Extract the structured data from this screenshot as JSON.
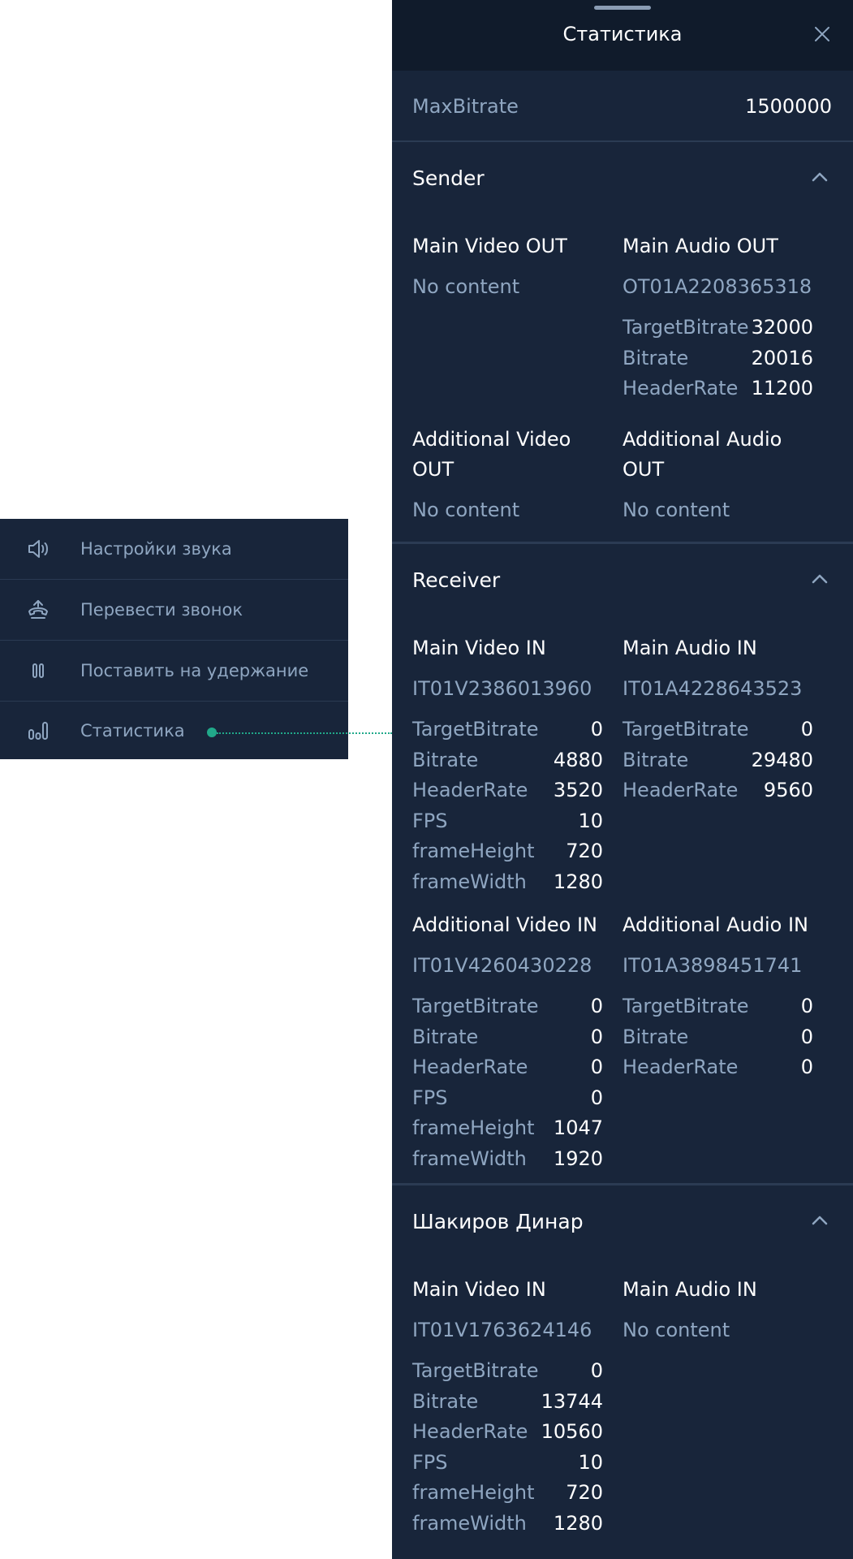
{
  "menu": {
    "items": [
      {
        "label": "Настройки звука",
        "icon": "speaker-icon"
      },
      {
        "label": "Перевести звонок",
        "icon": "call-transfer-icon"
      },
      {
        "label": "Поставить на удержание",
        "icon": "pause-icon"
      },
      {
        "label": "Статистика",
        "icon": "statistics-icon"
      }
    ]
  },
  "panel": {
    "title": "Статистика",
    "max_bitrate_label": "MaxBitrate",
    "max_bitrate_value": "1500000",
    "colors": {
      "panel_bg": "#18253a",
      "header_bg": "#101b2b",
      "accent": "#21a98a",
      "muted_text": "#8fa6c1"
    }
  },
  "sender": {
    "title": "Sender",
    "main_video": {
      "title": "Main Video OUT",
      "id": "No content"
    },
    "main_audio": {
      "title": "Main Audio OUT",
      "id": "OT01A2208365318",
      "stats": [
        {
          "k": "TargetBitrate",
          "v": "32000"
        },
        {
          "k": "Bitrate",
          "v": "20016"
        },
        {
          "k": "HeaderRate",
          "v": "11200"
        }
      ]
    },
    "add_video": {
      "title": "Additional Video OUT",
      "id": "No content"
    },
    "add_audio": {
      "title": "Additional Audio OUT",
      "id": "No content"
    }
  },
  "receiver": {
    "title": "Receiver",
    "main_video": {
      "title": "Main Video IN",
      "id": "IT01V2386013960",
      "stats": [
        {
          "k": "TargetBitrate",
          "v": "0"
        },
        {
          "k": "Bitrate",
          "v": "4880"
        },
        {
          "k": "HeaderRate",
          "v": "3520"
        },
        {
          "k": "FPS",
          "v": "10"
        },
        {
          "k": "frameHeight",
          "v": "720"
        },
        {
          "k": "frameWidth",
          "v": "1280"
        }
      ]
    },
    "main_audio": {
      "title": "Main Audio IN",
      "id": "IT01A4228643523",
      "stats": [
        {
          "k": "TargetBitrate",
          "v": "0"
        },
        {
          "k": "Bitrate",
          "v": "29480"
        },
        {
          "k": "HeaderRate",
          "v": "9560"
        }
      ]
    },
    "add_video": {
      "title": "Additional Video IN",
      "id": "IT01V4260430228",
      "stats": [
        {
          "k": "TargetBitrate",
          "v": "0"
        },
        {
          "k": "Bitrate",
          "v": "0"
        },
        {
          "k": "HeaderRate",
          "v": "0"
        },
        {
          "k": "FPS",
          "v": "0"
        },
        {
          "k": "frameHeight",
          "v": "1047"
        },
        {
          "k": "frameWidth",
          "v": "1920"
        }
      ]
    },
    "add_audio": {
      "title": "Additional Audio IN",
      "id": "IT01A3898451741",
      "stats": [
        {
          "k": "TargetBitrate",
          "v": "0"
        },
        {
          "k": "Bitrate",
          "v": "0"
        },
        {
          "k": "HeaderRate",
          "v": "0"
        }
      ]
    }
  },
  "participant": {
    "title": "Шакиров Динар",
    "main_video": {
      "title": "Main Video IN",
      "id": "IT01V1763624146",
      "stats": [
        {
          "k": "TargetBitrate",
          "v": "0"
        },
        {
          "k": "Bitrate",
          "v": "13744"
        },
        {
          "k": "HeaderRate",
          "v": "10560"
        },
        {
          "k": "FPS",
          "v": "10"
        },
        {
          "k": "frameHeight",
          "v": "720"
        },
        {
          "k": "frameWidth",
          "v": "1280"
        }
      ]
    },
    "main_audio": {
      "title": "Main Audio IN",
      "id": "No content"
    }
  }
}
